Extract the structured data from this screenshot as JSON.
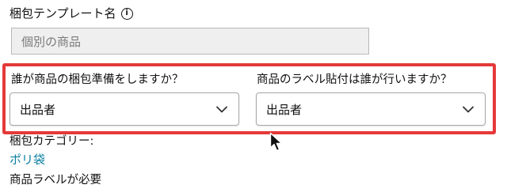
{
  "template": {
    "label": "梱包テンプレート名",
    "info_icon": "info-icon",
    "input_value": "個別の商品"
  },
  "prep_section": {
    "highlight_color": "#e53939",
    "prep_question": "誰が商品の梱包準備をしますか？",
    "prep_selected": "出品者",
    "label_question": "商品のラベル貼付は誰が行いますか？",
    "label_selected": "出品者",
    "dropdown_icon": "chevron-down-icon"
  },
  "category": {
    "label": "梱包カテゴリー:",
    "value": "ポリ袋",
    "link_color": "#0a7fa0"
  },
  "label_required": "商品ラベルが必要",
  "cursor_icon": "mouse-pointer-icon"
}
